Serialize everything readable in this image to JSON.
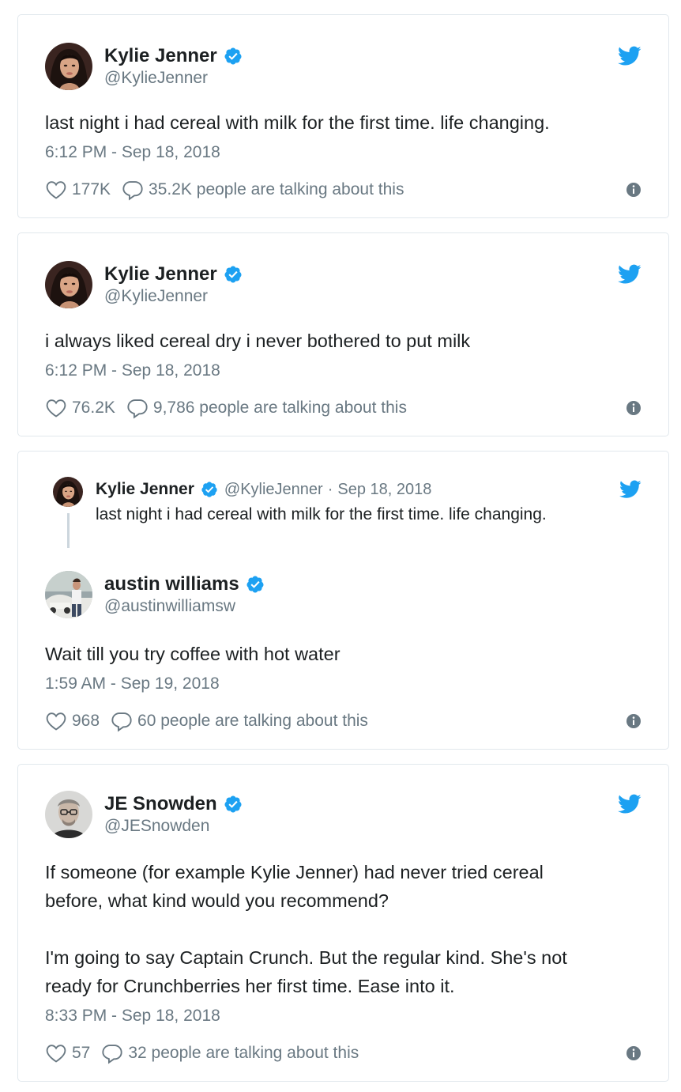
{
  "colors": {
    "twitter_blue": "#1da1f2",
    "text": "#1c2022",
    "secondary": "#697882",
    "border": "#e1e8ed"
  },
  "tweets": [
    {
      "name": "Kylie Jenner",
      "handle": "@KylieJenner",
      "verified": true,
      "text": "last night i had cereal with milk for the first time. life changing.",
      "time": "6:12 PM - Sep 18, 2018",
      "likes": "177K",
      "talking": "35.2K people are talking about this"
    },
    {
      "name": "Kylie Jenner",
      "handle": "@KylieJenner",
      "verified": true,
      "text": "i always liked cereal dry i never bothered to put milk",
      "time": "6:12 PM - Sep 18, 2018",
      "likes": "76.2K",
      "talking": "9,786 people are talking about this"
    },
    {
      "quoted": {
        "name": "Kylie Jenner",
        "handle": "@KylieJenner",
        "separator": "·",
        "date": "Sep 18, 2018",
        "text": "last night i had cereal with milk for the first time. life changing."
      },
      "name": "austin williams",
      "handle": "@austinwilliamsw",
      "verified": true,
      "text": "Wait till you try coffee with hot water",
      "time": "1:59 AM - Sep 19, 2018",
      "likes": "968",
      "talking": "60 people are talking about this"
    },
    {
      "name": "JE Snowden",
      "handle": "@JESnowden",
      "verified": true,
      "text": "If someone (for example Kylie Jenner) had never tried cereal\nbefore, what kind would you recommend?\n\nI'm going to say Captain Crunch. But the regular kind. She's not\nready for Crunchberries her first time. Ease into it.",
      "time": "8:33 PM - Sep 18, 2018",
      "likes": "57",
      "talking": "32 people are talking about this"
    }
  ],
  "icons": {
    "avatar": "profile-photo",
    "verified": "verified-badge-icon",
    "brand": "twitter-bird-icon",
    "like": "heart-icon",
    "reply": "speech-bubble-icon",
    "info": "info-icon"
  }
}
